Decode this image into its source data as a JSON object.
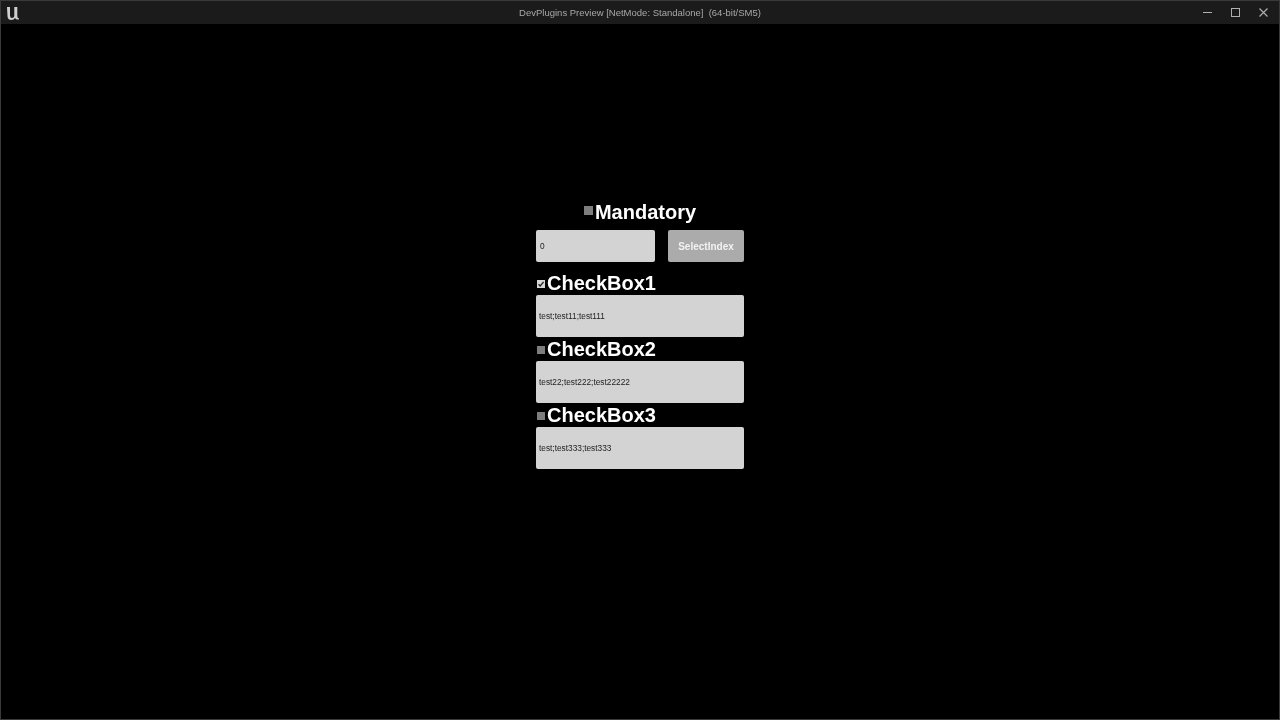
{
  "window": {
    "title": "DevPlugins Preview [NetMode: Standalone]  (64-bit/SM5)"
  },
  "mandatory": {
    "label": "Mandatory",
    "checked": false
  },
  "index_field": {
    "value": "0"
  },
  "select_button": {
    "label": "SelectIndex"
  },
  "checkboxes": [
    {
      "label": "CheckBox1",
      "checked": true,
      "text": "test;test11;test111"
    },
    {
      "label": "CheckBox2",
      "checked": false,
      "text": "test22;test222;test22222"
    },
    {
      "label": "CheckBox3",
      "checked": false,
      "text": "test;test333;test333"
    }
  ]
}
